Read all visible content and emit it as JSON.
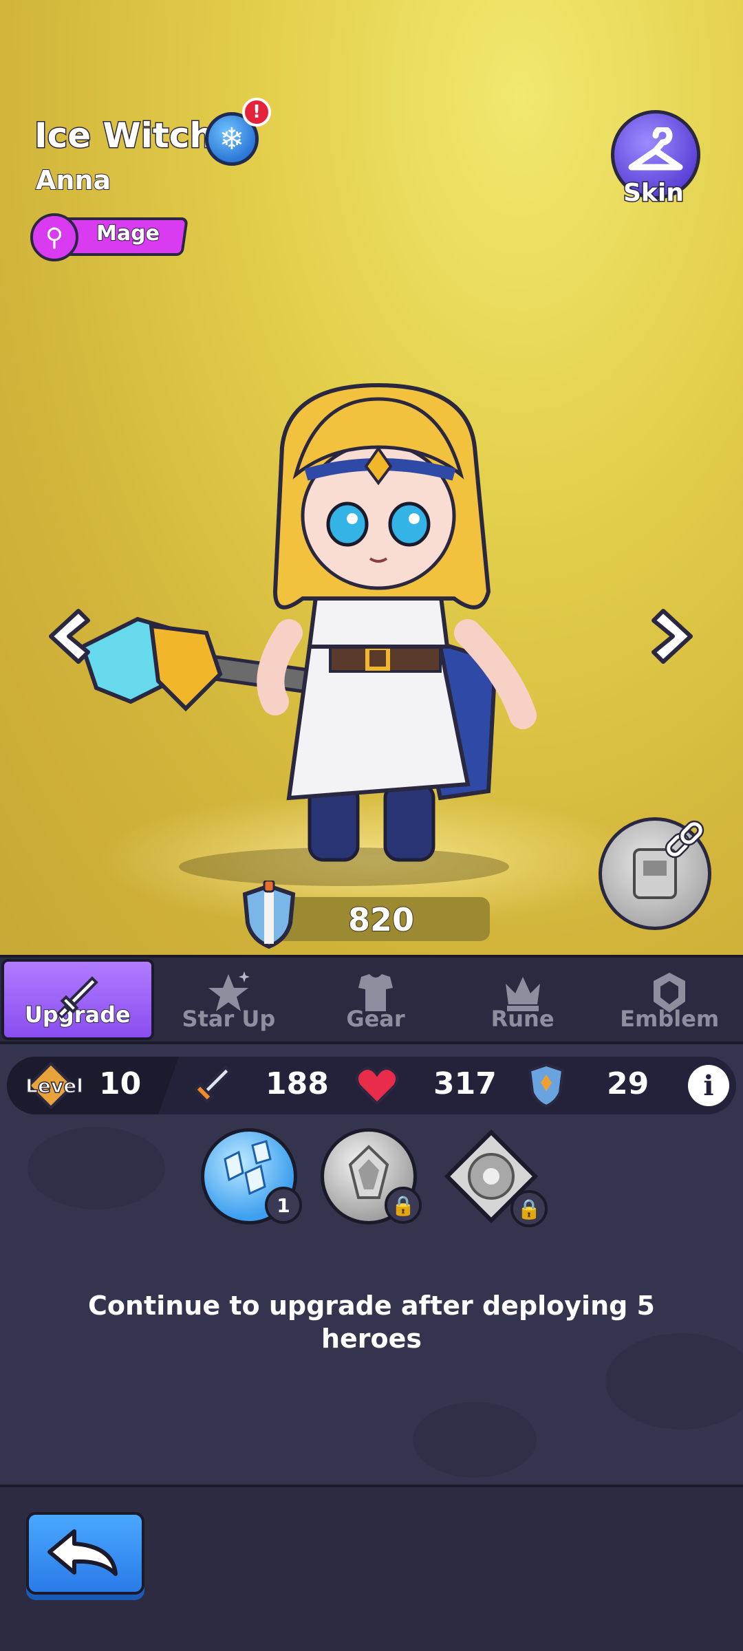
{
  "hero": {
    "name": "Ice Witch",
    "alert": "!",
    "element_icon": "snowflake-icon",
    "subname": "Anna",
    "class_label": "Mage",
    "class_icon": "mage-staff-icon",
    "power": "820"
  },
  "skin_button": {
    "label": "Skin",
    "icon": "hanger-icon"
  },
  "tabs": [
    {
      "label": "Upgrade",
      "icon": "sword-icon",
      "active": true
    },
    {
      "label": "Star Up",
      "icon": "star-icon",
      "active": false
    },
    {
      "label": "Gear",
      "icon": "armor-icon",
      "active": false
    },
    {
      "label": "Rune",
      "icon": "crown-icon",
      "active": false
    },
    {
      "label": "Emblem",
      "icon": "emblem-icon",
      "active": false
    }
  ],
  "stats": {
    "level_label": "Level",
    "level": "10",
    "attack": "188",
    "hp": "317",
    "defense": "29"
  },
  "skills": [
    {
      "name": "ice-skill",
      "badge": "1",
      "locked": false
    },
    {
      "name": "rune-skill",
      "locked": true
    },
    {
      "name": "gear-skill",
      "locked": true
    }
  ],
  "message": "Continue to upgrade after deploying 5 heroes",
  "colors": {
    "stage_bg": "#e3cf4b",
    "tab_active": "#8a4df0",
    "panel_bg": "#35344e",
    "back_button": "#2a7be8",
    "class_pill": "#d93cf0"
  }
}
